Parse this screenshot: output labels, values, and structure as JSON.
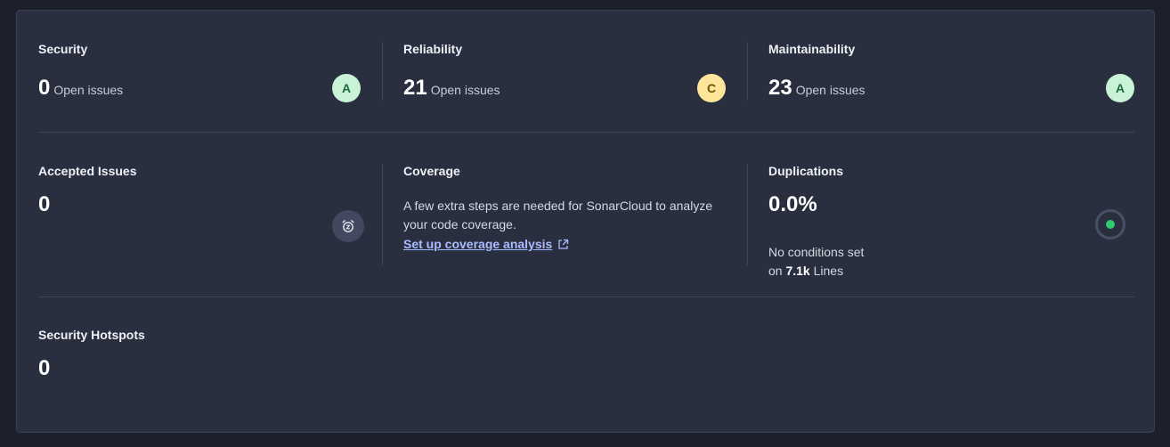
{
  "metrics": {
    "security": {
      "title": "Security",
      "value": "0",
      "unit": "Open issues",
      "rating": "A"
    },
    "reliability": {
      "title": "Reliability",
      "value": "21",
      "unit": "Open issues",
      "rating": "C"
    },
    "maintainability": {
      "title": "Maintainability",
      "value": "23",
      "unit": "Open issues",
      "rating": "A"
    },
    "accepted": {
      "title": "Accepted Issues",
      "value": "0",
      "icon": "alarm-clock-icon"
    },
    "coverage": {
      "title": "Coverage",
      "description": "A few extra steps are needed for SonarCloud to analyze your code coverage.",
      "link_label": "Set up coverage analysis",
      "link_icon": "external-link-icon"
    },
    "duplications": {
      "title": "Duplications",
      "value": "0.0%",
      "note_line1": "No conditions set",
      "note_prefix": "on",
      "note_lines": "7.1k",
      "note_suffix": "Lines",
      "indicator_color": "#2fca70"
    },
    "hotspots": {
      "title": "Security Hotspots",
      "value": "0"
    }
  },
  "colors": {
    "rating_a_bg": "#c9f2d6",
    "rating_c_bg": "#fde69a",
    "link": "#a9bcff"
  }
}
